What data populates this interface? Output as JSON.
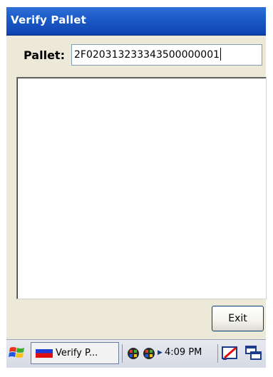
{
  "window": {
    "title": "Verify Pallet"
  },
  "form": {
    "pallet_label": "Pallet:",
    "pallet_value": "2F020313233343500000001"
  },
  "buttons": {
    "exit_label": "Exit"
  },
  "taskbar": {
    "task_label": "Verify P...",
    "clock": "4:09 PM"
  },
  "colors": {
    "title_bar": "#1d5cc8",
    "window_bg": "#ece9d8",
    "taskbar_bg": "#d6dae4"
  },
  "icons": [
    "windows-start-icon",
    "app-flag-icon",
    "network-icon",
    "network-icon-2",
    "tray-expand-arrow",
    "stylus-input-icon",
    "window-switch-icon"
  ]
}
